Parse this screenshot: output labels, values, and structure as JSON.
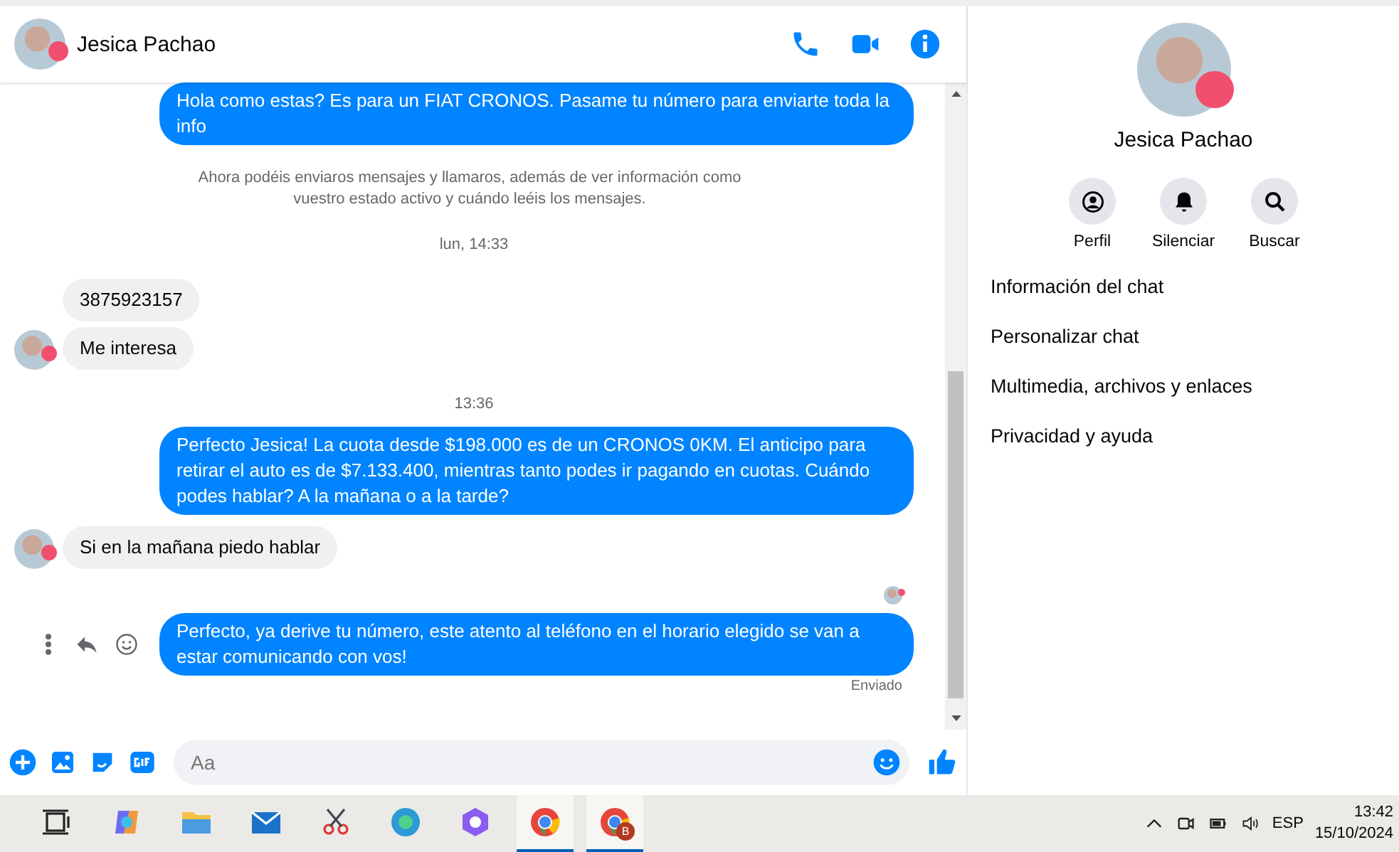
{
  "chat": {
    "contact_name": "Jesica Pachao",
    "messages": [
      {
        "kind": "outgoing",
        "text": "Hola como estas?  Es para un FIAT CRONOS. Pasame tu número para enviarte toda la info",
        "actions": false
      },
      {
        "kind": "info",
        "text": "Ahora podéis enviaros mensajes y llamaros, además de ver información como vuestro estado activo y cuándo leéis los mensajes."
      },
      {
        "kind": "time",
        "text": "lun, 14:33"
      },
      {
        "kind": "incoming",
        "text": "3875923157",
        "avatar": false
      },
      {
        "kind": "incoming",
        "text": "Me interesa",
        "avatar": true
      },
      {
        "kind": "time",
        "text": "13:36"
      },
      {
        "kind": "outgoing",
        "text": "Perfecto Jesica! La cuota desde $198.000 es de un CRONOS 0KM. El anticipo para retirar el auto es de $7.133.400, mientras tanto podes ir pagando en cuotas. Cuándo podes hablar? A la mañana o a la tarde?",
        "actions": false
      },
      {
        "kind": "incoming",
        "text": "Si en la mañana piedo hablar",
        "avatar": true
      },
      {
        "kind": "receipt"
      },
      {
        "kind": "outgoing",
        "text": "Perfecto, ya derive tu número, este atento al teléfono en el horario elegido se van a estar comunicando con vos!",
        "actions": true
      },
      {
        "kind": "status",
        "text": "Enviado"
      }
    ],
    "composer": {
      "placeholder": "Aa"
    }
  },
  "info_panel": {
    "name": "Jesica Pachao",
    "actions": [
      {
        "kind": "profile",
        "label": "Perfil"
      },
      {
        "kind": "mute",
        "label": "Silenciar"
      },
      {
        "kind": "search",
        "label": "Buscar"
      }
    ],
    "items": [
      "Información del chat",
      "Personalizar chat",
      "Multimedia, archivos y enlaces",
      "Privacidad y ayuda"
    ]
  },
  "taskbar": {
    "apps": [
      {
        "running": false
      },
      {
        "running": false
      },
      {
        "running": false
      },
      {
        "running": false
      },
      {
        "running": false
      },
      {
        "running": false
      },
      {
        "running": false
      },
      {
        "running": true
      },
      {
        "running": true,
        "badge": "B"
      }
    ],
    "language": "ESP",
    "time": "13:42",
    "date": "15/10/2024"
  }
}
